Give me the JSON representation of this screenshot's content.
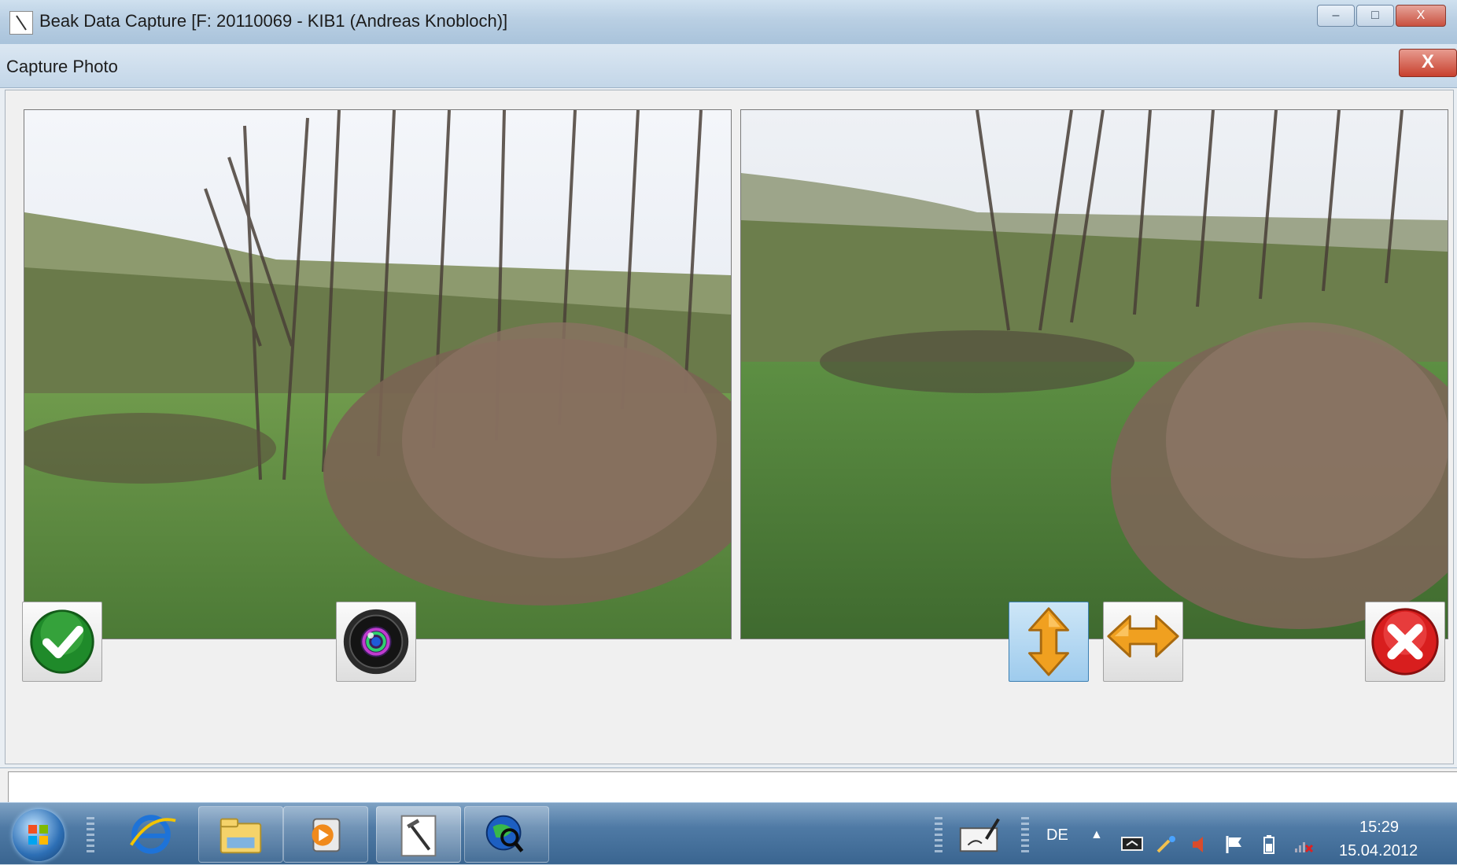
{
  "window": {
    "title": "Beak Data Capture [F: 20110069 - KIB1 (Andreas Knobloch)]",
    "controls": {
      "minimize": "–",
      "maximize": "□",
      "close": "X"
    }
  },
  "dialog": {
    "title": "Capture Photo",
    "close_label": "X"
  },
  "photos": {
    "left_alt": "Captured photo of shrub and meadow",
    "right_alt": "Live camera view of shrub and meadow"
  },
  "buttons": {
    "accept": {
      "icon": "checkmark-icon",
      "color": "#1f8a2a"
    },
    "capture": {
      "icon": "camera-lens-icon"
    },
    "flip_vertical": {
      "icon": "vertical-arrows-icon",
      "color": "#f0a020",
      "active": true
    },
    "flip_horizontal": {
      "icon": "horizontal-arrows-icon",
      "color": "#f0a020"
    },
    "cancel": {
      "icon": "close-x-icon",
      "color": "#d81e1e"
    }
  },
  "taskbar": {
    "items": [
      "internet-explorer-icon",
      "file-explorer-icon",
      "media-player-icon",
      "beak-data-capture-icon",
      "globe-search-icon"
    ],
    "language": "DE",
    "time": "15:29",
    "date": "15.04.2012"
  }
}
